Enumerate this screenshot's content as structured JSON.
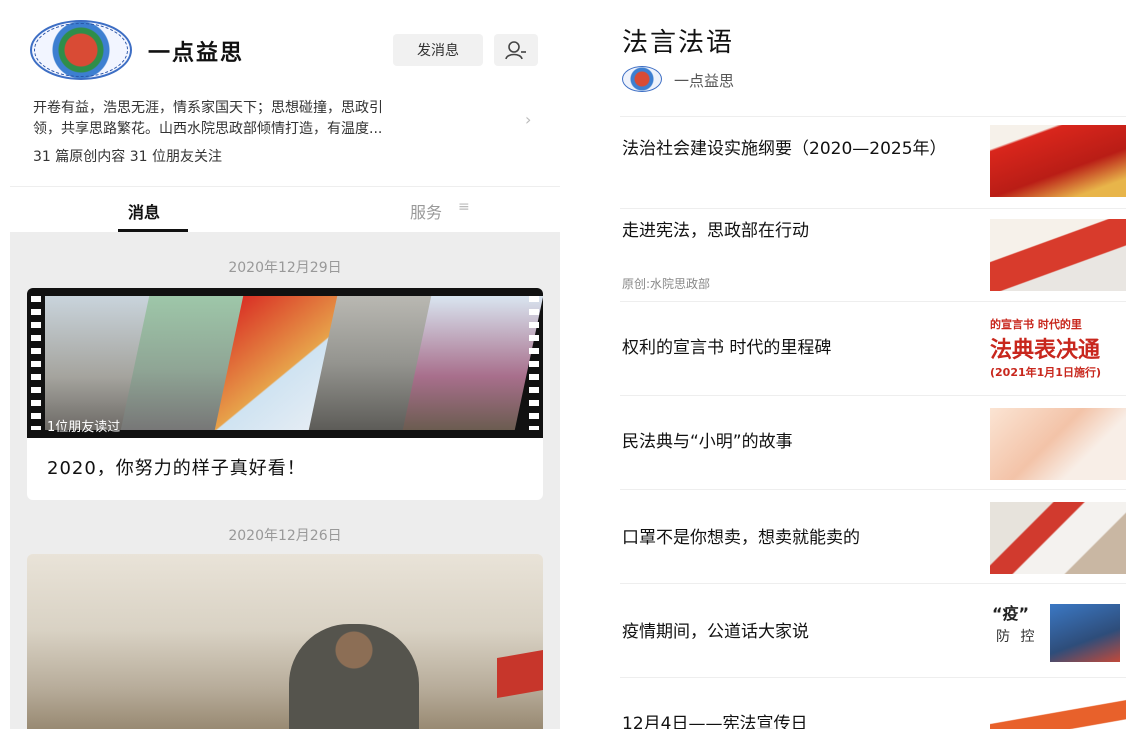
{
  "left": {
    "account_name": "一点益思",
    "send_message_label": "发消息",
    "description_line1": "开卷有益，浩思无涯，情系家国天下；思想碰撞，思政引",
    "description_line2": "领，共享思路繁花。山西水院思政部倾情打造，有温度...",
    "stats": "31 篇原创内容  31 位朋友关注",
    "tabs": [
      "消息",
      "服务"
    ],
    "feed": [
      {
        "date": "2020年12月29日",
        "friend_read": "1位朋友读过",
        "title": "2020，你努力的样子真好看！"
      },
      {
        "date": "2020年12月26日"
      }
    ]
  },
  "right": {
    "album_title": "法言法语",
    "account_name": "一点益思",
    "articles": [
      {
        "title": "法治社会建设实施纲要（2020—2025年）"
      },
      {
        "title": "走进宪法，思政部在行动",
        "subtitle": "原创:水院思政部"
      },
      {
        "title": "权利的宣言书 时代的里程碑",
        "thumb_lines": [
          "的宣言书 时代的里",
          "法典表决通",
          "(2021年1月1日施行)"
        ]
      },
      {
        "title": "民法典与“小明”的故事"
      },
      {
        "title": "口罩不是你想卖，想卖就能卖的"
      },
      {
        "title": "疫情期间，公道话大家说",
        "thumb_lines": [
          "“疫”",
          "防 控"
        ]
      },
      {
        "title": "12月4日——宪法宣传日"
      }
    ]
  },
  "icons": [
    "profile-icon",
    "chevron-right-icon",
    "menu-lines-icon"
  ]
}
